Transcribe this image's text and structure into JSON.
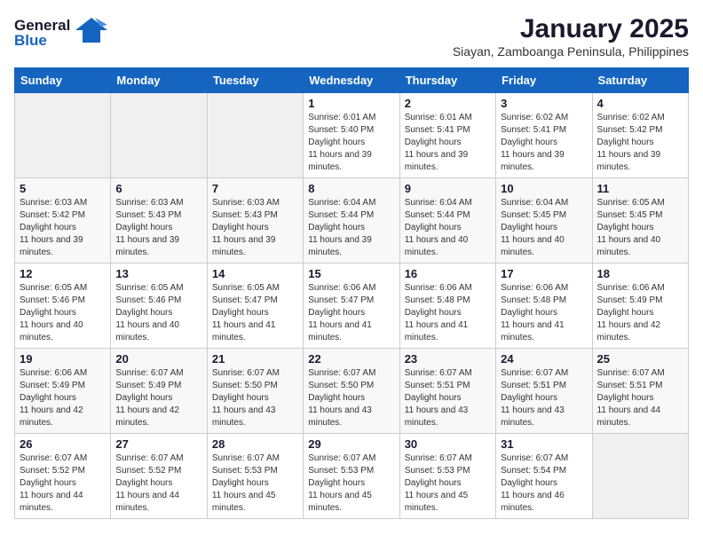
{
  "header": {
    "logo_general": "General",
    "logo_blue": "Blue",
    "title": "January 2025",
    "subtitle": "Siayan, Zamboanga Peninsula, Philippines"
  },
  "days_of_week": [
    "Sunday",
    "Monday",
    "Tuesday",
    "Wednesday",
    "Thursday",
    "Friday",
    "Saturday"
  ],
  "weeks": [
    [
      {
        "day": "",
        "empty": true
      },
      {
        "day": "",
        "empty": true
      },
      {
        "day": "",
        "empty": true
      },
      {
        "day": "1",
        "sunrise": "6:01 AM",
        "sunset": "5:40 PM",
        "daylight": "11 hours and 39 minutes."
      },
      {
        "day": "2",
        "sunrise": "6:01 AM",
        "sunset": "5:41 PM",
        "daylight": "11 hours and 39 minutes."
      },
      {
        "day": "3",
        "sunrise": "6:02 AM",
        "sunset": "5:41 PM",
        "daylight": "11 hours and 39 minutes."
      },
      {
        "day": "4",
        "sunrise": "6:02 AM",
        "sunset": "5:42 PM",
        "daylight": "11 hours and 39 minutes."
      }
    ],
    [
      {
        "day": "5",
        "sunrise": "6:03 AM",
        "sunset": "5:42 PM",
        "daylight": "11 hours and 39 minutes."
      },
      {
        "day": "6",
        "sunrise": "6:03 AM",
        "sunset": "5:43 PM",
        "daylight": "11 hours and 39 minutes."
      },
      {
        "day": "7",
        "sunrise": "6:03 AM",
        "sunset": "5:43 PM",
        "daylight": "11 hours and 39 minutes."
      },
      {
        "day": "8",
        "sunrise": "6:04 AM",
        "sunset": "5:44 PM",
        "daylight": "11 hours and 39 minutes."
      },
      {
        "day": "9",
        "sunrise": "6:04 AM",
        "sunset": "5:44 PM",
        "daylight": "11 hours and 40 minutes."
      },
      {
        "day": "10",
        "sunrise": "6:04 AM",
        "sunset": "5:45 PM",
        "daylight": "11 hours and 40 minutes."
      },
      {
        "day": "11",
        "sunrise": "6:05 AM",
        "sunset": "5:45 PM",
        "daylight": "11 hours and 40 minutes."
      }
    ],
    [
      {
        "day": "12",
        "sunrise": "6:05 AM",
        "sunset": "5:46 PM",
        "daylight": "11 hours and 40 minutes."
      },
      {
        "day": "13",
        "sunrise": "6:05 AM",
        "sunset": "5:46 PM",
        "daylight": "11 hours and 40 minutes."
      },
      {
        "day": "14",
        "sunrise": "6:05 AM",
        "sunset": "5:47 PM",
        "daylight": "11 hours and 41 minutes."
      },
      {
        "day": "15",
        "sunrise": "6:06 AM",
        "sunset": "5:47 PM",
        "daylight": "11 hours and 41 minutes."
      },
      {
        "day": "16",
        "sunrise": "6:06 AM",
        "sunset": "5:48 PM",
        "daylight": "11 hours and 41 minutes."
      },
      {
        "day": "17",
        "sunrise": "6:06 AM",
        "sunset": "5:48 PM",
        "daylight": "11 hours and 41 minutes."
      },
      {
        "day": "18",
        "sunrise": "6:06 AM",
        "sunset": "5:49 PM",
        "daylight": "11 hours and 42 minutes."
      }
    ],
    [
      {
        "day": "19",
        "sunrise": "6:06 AM",
        "sunset": "5:49 PM",
        "daylight": "11 hours and 42 minutes."
      },
      {
        "day": "20",
        "sunrise": "6:07 AM",
        "sunset": "5:49 PM",
        "daylight": "11 hours and 42 minutes."
      },
      {
        "day": "21",
        "sunrise": "6:07 AM",
        "sunset": "5:50 PM",
        "daylight": "11 hours and 43 minutes."
      },
      {
        "day": "22",
        "sunrise": "6:07 AM",
        "sunset": "5:50 PM",
        "daylight": "11 hours and 43 minutes."
      },
      {
        "day": "23",
        "sunrise": "6:07 AM",
        "sunset": "5:51 PM",
        "daylight": "11 hours and 43 minutes."
      },
      {
        "day": "24",
        "sunrise": "6:07 AM",
        "sunset": "5:51 PM",
        "daylight": "11 hours and 43 minutes."
      },
      {
        "day": "25",
        "sunrise": "6:07 AM",
        "sunset": "5:51 PM",
        "daylight": "11 hours and 44 minutes."
      }
    ],
    [
      {
        "day": "26",
        "sunrise": "6:07 AM",
        "sunset": "5:52 PM",
        "daylight": "11 hours and 44 minutes."
      },
      {
        "day": "27",
        "sunrise": "6:07 AM",
        "sunset": "5:52 PM",
        "daylight": "11 hours and 44 minutes."
      },
      {
        "day": "28",
        "sunrise": "6:07 AM",
        "sunset": "5:53 PM",
        "daylight": "11 hours and 45 minutes."
      },
      {
        "day": "29",
        "sunrise": "6:07 AM",
        "sunset": "5:53 PM",
        "daylight": "11 hours and 45 minutes."
      },
      {
        "day": "30",
        "sunrise": "6:07 AM",
        "sunset": "5:53 PM",
        "daylight": "11 hours and 45 minutes."
      },
      {
        "day": "31",
        "sunrise": "6:07 AM",
        "sunset": "5:54 PM",
        "daylight": "11 hours and 46 minutes."
      },
      {
        "day": "",
        "empty": true
      }
    ]
  ],
  "labels": {
    "sunrise": "Sunrise:",
    "sunset": "Sunset:",
    "daylight": "Daylight hours"
  }
}
